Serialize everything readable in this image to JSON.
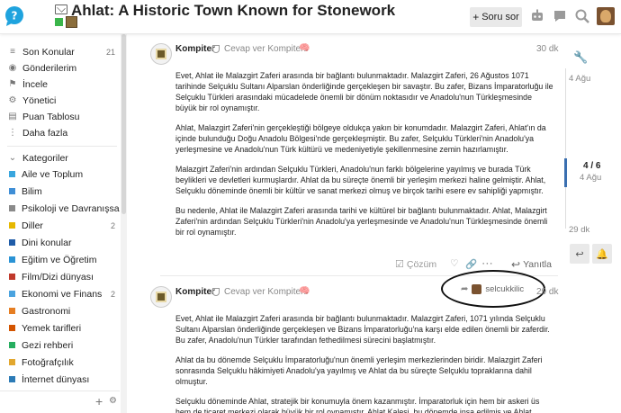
{
  "header": {
    "title": "Ahlat: A Historic Town Known for Stonework",
    "ask_button": "Soru sor",
    "logo_icon": "chat-question-icon"
  },
  "sidebar": {
    "top_items": [
      {
        "label": "Son Konular",
        "count": "21",
        "icon": "topics-icon"
      },
      {
        "label": "Gönderilerim",
        "count": "",
        "icon": "user-icon"
      },
      {
        "label": "İncele",
        "count": "",
        "icon": "review-icon"
      },
      {
        "label": "Yönetici",
        "count": "",
        "icon": "wrench-icon"
      },
      {
        "label": "Puan Tablosu",
        "count": "",
        "icon": "trophy-icon"
      },
      {
        "label": "Daha fazla",
        "count": "",
        "icon": "more-icon"
      }
    ],
    "categories_header": "Kategoriler",
    "categories": [
      {
        "label": "Aile ve Toplum",
        "count": "",
        "color": "#39a6de"
      },
      {
        "label": "Bilim",
        "count": "",
        "color": "#3f8ed6"
      },
      {
        "label": "Psikoloji ve Davranışsal ...",
        "count": "",
        "color": "#8a8a8a"
      },
      {
        "label": "Diller",
        "count": "2",
        "color": "#e6b800"
      },
      {
        "label": "Dini konular",
        "count": "",
        "color": "#1f5ca8"
      },
      {
        "label": "Eğitim ve Öğretim",
        "count": "",
        "color": "#2a93d5"
      },
      {
        "label": "Film/Dizi dünyası",
        "count": "",
        "color": "#c0392b"
      },
      {
        "label": "Ekonomi ve Finans",
        "count": "2",
        "color": "#4aa3df"
      },
      {
        "label": "Gastronomi",
        "count": "",
        "color": "#e67e22"
      },
      {
        "label": "Yemek tarifleri",
        "count": "",
        "color": "#d35400"
      },
      {
        "label": "Gezi rehberi",
        "count": "",
        "color": "#27ae60"
      },
      {
        "label": "Fotoğrafçılık",
        "count": "",
        "color": "#e2a72e"
      },
      {
        "label": "İnternet dünyası",
        "count": "",
        "color": "#2c7bb6"
      }
    ]
  },
  "posts": [
    {
      "username": "Kompiter",
      "reply_label": "Cevap ver Kompiter!",
      "time": "30 dk",
      "paragraphs": [
        "Evet, Ahlat ile Malazgirt Zaferi arasında bir bağlantı bulunmaktadır. Malazgirt Zaferi, 26 Ağustos 1071 tarihinde Selçuklu Sultanı Alparslan önderliğinde gerçekleşen bir savaştır. Bu zafer, Bizans İmparatorluğu ile Selçuklu Türkleri arasındaki mücadelede önemli bir dönüm noktasıdır ve Anadolu'nun Türkleşmesinde büyük bir rol oynamıştır.",
        "Ahlat, Malazgirt Zaferi'nin gerçekleştiği bölgeye oldukça yakın bir konumdadır. Malazgirt Zaferi, Ahlat'ın da içinde bulunduğu Doğu Anadolu Bölgesi'nde gerçekleşmiştir. Bu zafer, Selçuklu Türkleri'nin Anadolu'ya yerleşmesine ve Anadolu'nun Türk kültürü ve medeniyetiyle şekillenmesine zemin hazırlamıştır.",
        "Malazgirt Zaferi'nin ardından Selçuklu Türkleri, Anadolu'nun farklı bölgelerine yayılmış ve burada Türk beylikleri ve devletleri kurmuşlardır. Ahlat da bu süreçte önemli bir yerleşim merkezi haline gelmiştir. Ahlat, Selçuklu döneminde önemli bir kültür ve sanat merkezi olmuş ve birçok tarihi esere ev sahipliği yapmıştır.",
        "Bu nedenle, Ahlat ile Malazgirt Zaferi arasında tarihi ve kültürel bir bağlantı bulunmaktadır. Ahlat, Malazgirt Zaferi'nin ardından Selçuklu Türkleri'nin Anadolu'ya yerleşmesinde ve Anadolu'nun Türkleşmesinde önemli bir rol oynamıştır."
      ],
      "solution_label": "Çözüm",
      "reply_button": "Yanıtla"
    },
    {
      "username": "Kompiter",
      "reply_label": "Cevap ver Kompiter!",
      "time": "29 dk",
      "reply_to": "selcukkilic",
      "paragraphs": [
        "Evet, Ahlat ile Malazgirt Zaferi arasında bir bağlantı bulunmaktadır. Malazgirt Zaferi, 1071 yılında Selçuklu Sultanı Alparslan önderliğinde gerçekleşen ve Bizans İmparatorluğu'na karşı elde edilen önemli bir zaferdir. Bu zafer, Anadolu'nun Türkler tarafından fethedilmesi sürecini başlatmıştır.",
        "Ahlat da bu dönemde Selçuklu İmparatorluğu'nun önemli yerleşim merkezlerinden biridir. Malazgirt Zaferi sonrasında Selçuklu hâkimiyeti Anadolu'ya yayılmış ve Ahlat da bu süreçte Selçuklu topraklarına dahil olmuştur.",
        "Selçuklu döneminde Ahlat, stratejik bir konumuyla önem kazanmıştır. İmparatorluk için hem bir askeri üs hem de ticaret merkezi olarak büyük bir rol oynamıştır. Ahlat Kalesi, bu dönemde inşa edilmiş ve Ahlat"
      ]
    }
  ],
  "timeline": {
    "top_date": "4 Ağu",
    "position": "4 / 6",
    "position_date": "4 Ağu",
    "bottom_date": "29 dk",
    "progress": 0.67
  }
}
